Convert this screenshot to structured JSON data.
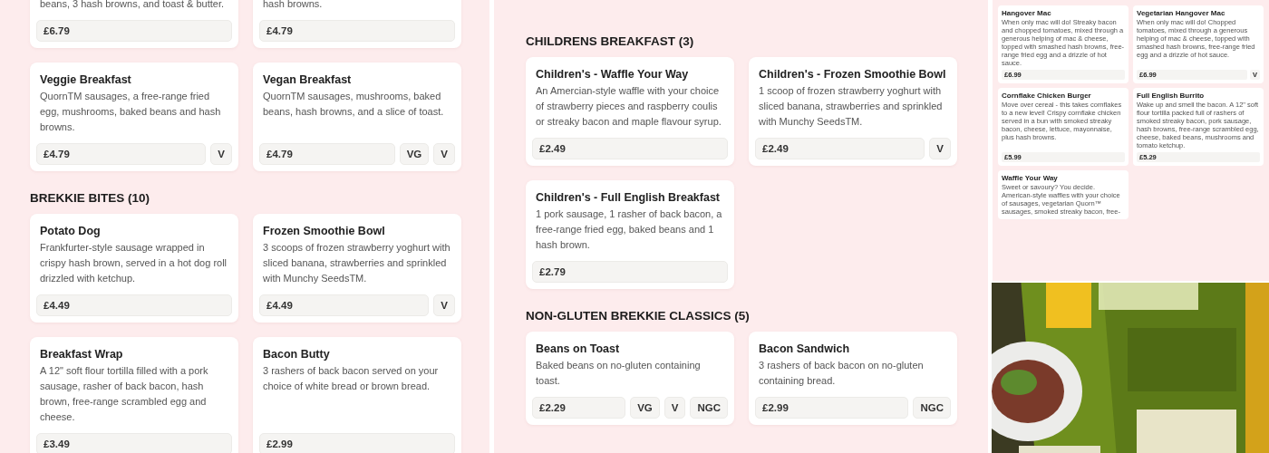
{
  "panels": [
    {
      "kind": "menu",
      "sections": [
        {
          "cards": [
            {
              "description": "beans, 3 hash browns, and toast & butter.",
              "price": "£6.79"
            },
            {
              "description": "hash browns.",
              "price": "£4.79"
            }
          ]
        },
        {
          "cards": [
            {
              "name": "Veggie Breakfast",
              "description": "QuornTM sausages, a free-range fried egg, mushrooms, baked beans and hash browns.",
              "price": "£4.79",
              "tags": [
                "V"
              ]
            },
            {
              "name": "Vegan Breakfast",
              "description": "QuornTM sausages, mushrooms, baked beans, hash browns, and a slice of toast.",
              "price": "£4.79",
              "tags": [
                "VG",
                "V"
              ]
            }
          ]
        },
        {
          "title": "BREKKIE BITES (10)",
          "cards": [
            {
              "name": "Potato Dog",
              "description": "Frankfurter-style sausage wrapped in crispy hash brown, served in a hot dog roll drizzled with ketchup.",
              "price": "£4.49"
            },
            {
              "name": "Frozen Smoothie Bowl",
              "description": "3 scoops of frozen strawberry yoghurt with sliced banana, strawberries and sprinkled with Munchy SeedsTM.",
              "price": "£4.49",
              "tags": [
                "V"
              ]
            },
            {
              "name": "Breakfast Wrap",
              "description": "A 12\" soft flour tortilla filled with a pork sausage, rasher of back bacon, hash brown, free-range scrambled egg and cheese.",
              "price": "£3.49"
            },
            {
              "name": "Bacon Butty",
              "description": "3 rashers of back bacon served on your choice of white bread or brown bread.",
              "price": "£2.99"
            }
          ]
        }
      ]
    },
    {
      "kind": "menu",
      "sections": [
        {
          "title": "CHILDRENS BREAKFAST (3)",
          "cards": [
            {
              "name": "Children's - Waffle Your Way",
              "description": "An Amercian-style waffle with your choice of strawberry pieces and raspberry coulis or streaky bacon and maple flavour syrup.",
              "price": "£2.49"
            },
            {
              "name": "Children's - Frozen Smoothie Bowl",
              "description": "1 scoop of frozen strawberry yoghurt with sliced banana, strawberries and sprinkled with Munchy SeedsTM.",
              "price": "£2.49",
              "tags": [
                "V"
              ]
            },
            {
              "name": "Children's - Full English Breakfast",
              "description": "1 pork sausage, 1 rasher of back bacon, a free-range fried egg, baked beans and 1 hash brown.",
              "price": "£2.79"
            }
          ]
        },
        {
          "title": "NON-GLUTEN BREKKIE CLASSICS (5)",
          "cards": [
            {
              "name": "Beans on Toast",
              "description": "Baked beans on no-gluten containing toast.",
              "price": "£2.29",
              "tags": [
                "VG",
                "V",
                "NGC"
              ]
            },
            {
              "name": "Bacon Sandwich",
              "description": "3 rashers of back bacon on no-gluten containing bread.",
              "price": "£2.99",
              "tags": [
                "NGC"
              ]
            }
          ]
        }
      ]
    },
    {
      "kind": "small-menu",
      "sections": [
        {
          "cards": [
            {
              "name": "Hangover Mac",
              "description": "When only mac will do! Streaky bacon and chopped tomatoes, mixed through a generous helping of mac & cheese, topped with smashed hash browns, free-range fried egg and a drizzle of hot sauce.",
              "price": "£6.99"
            },
            {
              "name": "Vegetarian Hangover Mac",
              "description": "When only mac will do! Chopped tomatoes, mixed through a generous helping of mac & cheese, topped with smashed hash browns, free-range fried egg and a drizzle of hot sauce.",
              "price": "£6.99",
              "tags": [
                "V"
              ]
            },
            {
              "name": "Cornflake Chicken Burger",
              "description": "Move over cereal - this takes cornflakes to a new level! Crispy cornflake chicken served in a bun with smoked streaky bacon, cheese, lettuce, mayonnaise, plus hash browns.",
              "price": "£5.99"
            },
            {
              "name": "Full English Burrito",
              "description": "Wake up and smell the bacon. A 12\" soft flour tortilla packed full of rashers of smoked streaky bacon, pork sausage, hash browns, free-range scrambled egg, cheese, baked beans, mushrooms and tomato ketchup.",
              "price": "£5.29"
            },
            {
              "name": "Waffle Your Way",
              "description": "Sweet or savoury? You decide. American-style waffles with your choice of sausages, vegetarian Quorn™ sausages, smoked streaky bacon, free-"
            }
          ]
        }
      ]
    },
    {
      "kind": "picture"
    }
  ]
}
